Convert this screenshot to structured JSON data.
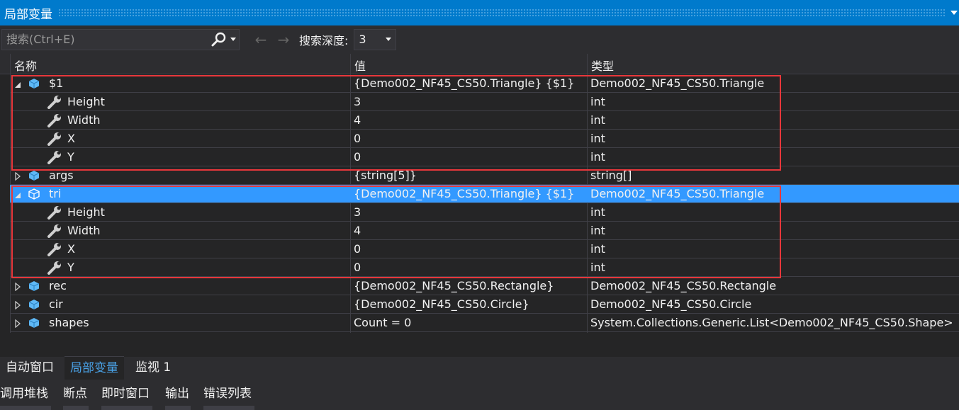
{
  "panel": {
    "title": "局部变量"
  },
  "toolbar": {
    "search_placeholder": "搜索(Ctrl+E)",
    "depth_label": "搜索深度:",
    "depth_value": "3"
  },
  "columns": {
    "name": "名称",
    "value": "值",
    "type": "类型"
  },
  "rows": [
    {
      "name": "$1",
      "value": "{Demo002_NF45_CS50.Triangle} {$1}",
      "type": "Demo002_NF45_CS50.Triangle"
    },
    {
      "name": "Height",
      "value": "3",
      "type": "int"
    },
    {
      "name": "Width",
      "value": "4",
      "type": "int"
    },
    {
      "name": "X",
      "value": "0",
      "type": "int"
    },
    {
      "name": "Y",
      "value": "0",
      "type": "int"
    },
    {
      "name": "args",
      "value": "{string[5]}",
      "type": "string[]"
    },
    {
      "name": "tri",
      "value": "{Demo002_NF45_CS50.Triangle} {$1}",
      "type": "Demo002_NF45_CS50.Triangle"
    },
    {
      "name": "Height",
      "value": "3",
      "type": "int"
    },
    {
      "name": "Width",
      "value": "4",
      "type": "int"
    },
    {
      "name": "X",
      "value": "0",
      "type": "int"
    },
    {
      "name": "Y",
      "value": "0",
      "type": "int"
    },
    {
      "name": "rec",
      "value": "{Demo002_NF45_CS50.Rectangle}",
      "type": "Demo002_NF45_CS50.Rectangle"
    },
    {
      "name": "cir",
      "value": "{Demo002_NF45_CS50.Circle}",
      "type": "Demo002_NF45_CS50.Circle"
    },
    {
      "name": "shapes",
      "value": "Count = 0",
      "type": "System.Collections.Generic.List<Demo002_NF45_CS50.Shape>"
    }
  ],
  "tabs": [
    "自动窗口",
    "局部变量",
    "监视 1"
  ],
  "bottom_tabs": [
    "调用堆栈",
    "断点",
    "即时窗口",
    "输出",
    "错误列表"
  ],
  "colors": {
    "accent": "#007acc",
    "selection": "#3399ff",
    "highlight_box": "#e8373b"
  }
}
